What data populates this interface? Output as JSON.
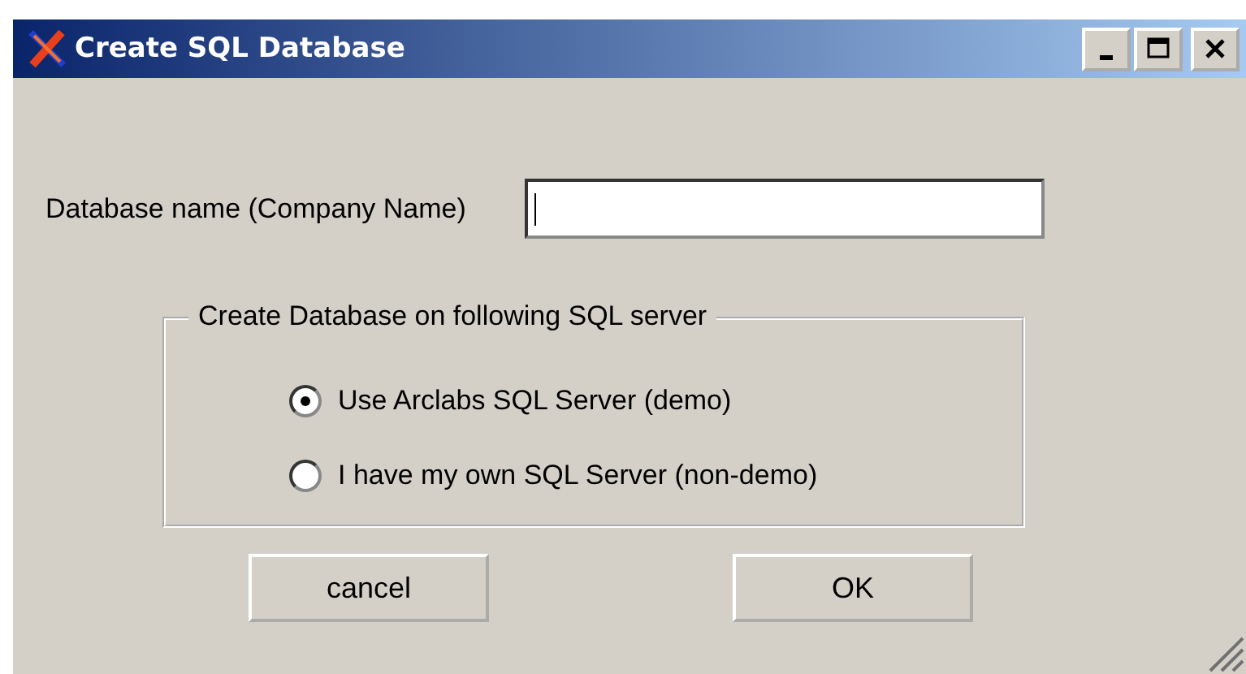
{
  "window": {
    "title": "Create SQL Database"
  },
  "name_field": {
    "label": "Database name (Company Name)"
  },
  "server_group": {
    "legend": "Create Database on following SQL server",
    "options": [
      {
        "label": "Use Arclabs SQL Server (demo)",
        "selected": true
      },
      {
        "label": "I have my own SQL Server (non-demo)",
        "selected": false
      }
    ]
  },
  "buttons": [
    {
      "label": "cancel"
    },
    {
      "label": "OK"
    }
  ]
}
